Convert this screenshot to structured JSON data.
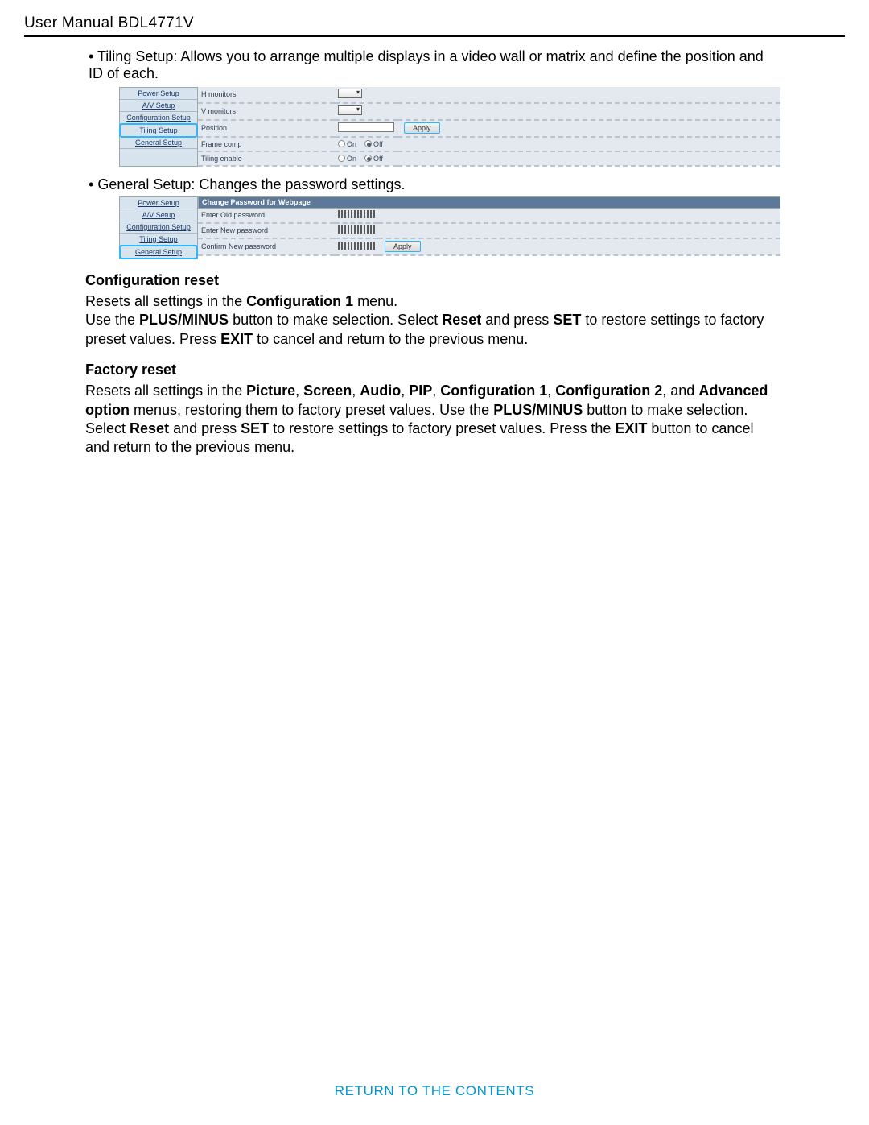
{
  "header": "User Manual BDL4771V",
  "bullets": {
    "tiling": "Tiling Setup: Allows you to arrange multiple displays in a video wall or matrix and define the position and ID of each.",
    "general": "General Setup: Changes the password settings."
  },
  "sidebar": {
    "items": [
      "Power Setup",
      "A/V Setup",
      "Configuration Setup",
      "Tiling Setup",
      "General Setup"
    ]
  },
  "tiling_panel": {
    "rows": {
      "h": "H monitors",
      "v": "V monitors",
      "pos": "Position",
      "frame": "Frame comp",
      "enable": "Tiling enable"
    },
    "apply": "Apply",
    "radio_on": "On",
    "radio_off": "Off"
  },
  "general_panel": {
    "title": "Change Password for Webpage",
    "rows": {
      "old": "Enter Old password",
      "new": "Enter New password",
      "confirm": "Confirm New password"
    },
    "apply": "Apply"
  },
  "sections": {
    "config_reset": {
      "title": "Configuration reset",
      "p1a": "Resets all settings in the ",
      "p1b": "Configuration 1",
      "p1c": " menu.",
      "p2a": "Use the ",
      "p2b": "PLUS/MINUS",
      "p2c": " button to make selection. Select ",
      "p2d": "Reset",
      "p2e": " and press ",
      "p2f": "SET",
      "p2g": " to restore settings to factory preset values. Press ",
      "p2h": "EXIT",
      "p2i": " to cancel and return to the previous menu."
    },
    "factory_reset": {
      "title": "Factory reset",
      "a": "Resets all settings in the ",
      "b": "Picture",
      "c": ", ",
      "d": "Screen",
      "e": ", ",
      "f": "Audio",
      "g": ", ",
      "h": "PIP",
      "i": ", ",
      "j": "Configuration 1",
      "k": ", ",
      "l": "Configuration 2",
      "m": ", and ",
      "n": "Advanced option",
      "o": " menus, restoring them to factory preset values. Use the ",
      "p": "PLUS/MINUS",
      "q": " button to make selection. Select ",
      "r": "Reset",
      "s": " and press ",
      "t": "SET",
      "u": " to restore settings to factory preset values. Press the ",
      "v": "EXIT",
      "w": " button to cancel and return to the previous menu."
    }
  },
  "footer": "Return to the Contents"
}
